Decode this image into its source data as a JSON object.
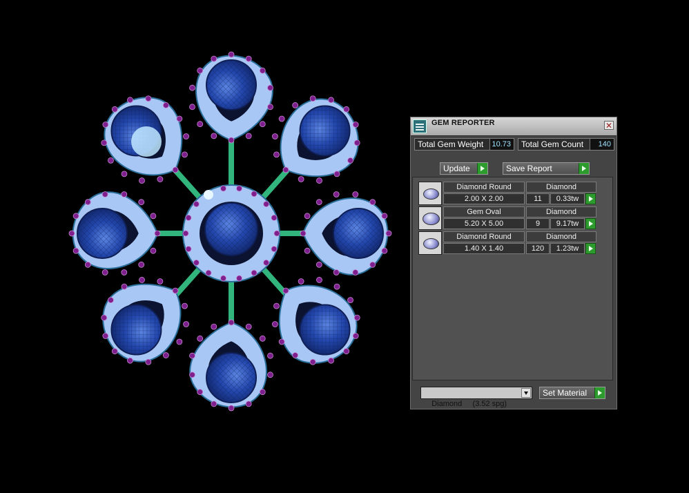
{
  "viewport": {
    "gem_colors": {
      "sapphire": "#1d3f9e",
      "sapphire_light": "#4d78d8",
      "diamond": "#a9c7f5",
      "accent": "#7e1f8d",
      "metal": "#36c98a"
    }
  },
  "panel": {
    "title": "GEM REPORTER",
    "app_icon": "gem-reporter-icon",
    "close_icon": "close-icon",
    "total_weight_label": "Total Gem Weight",
    "total_weight_value": "10.73",
    "total_count_label": "Total Gem Count",
    "total_count_value": "140",
    "update_label": "Update",
    "save_report_label": "Save Report",
    "gems": [
      {
        "name": "Diamond Round",
        "material": "Diamond",
        "size": "2.00 X 2.00",
        "count": "11",
        "weight": "0.33tw"
      },
      {
        "name": "Gem Oval",
        "material": "Diamond",
        "size": "5.20 X 5.00",
        "count": "9",
        "weight": "9.17tw"
      },
      {
        "name": "Diamond Round",
        "material": "Diamond",
        "size": "1.40 X 1.40",
        "count": "120",
        "weight": "1.23tw"
      }
    ],
    "material_select": "Diamond     (3.52 spg)",
    "set_material_label": "Set Material"
  }
}
